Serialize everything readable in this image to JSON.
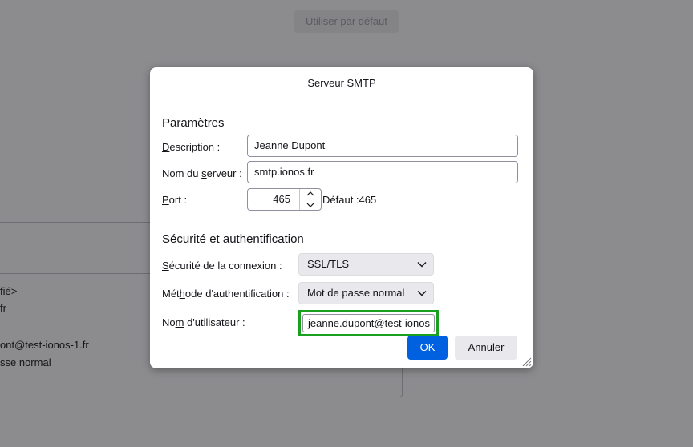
{
  "background": {
    "default_button_label": "Utiliser par défaut",
    "lines": [
      "fié>",
      "fr",
      "ont@test-ionos-1.fr",
      "sse normal"
    ]
  },
  "dialog": {
    "title": "Serveur SMTP",
    "settings_section": "Paramètres",
    "description_label_first": "D",
    "description_label_rest": "escription :",
    "description_value": "Jeanne Dupont",
    "server_label_pre": "Nom du ",
    "server_label_mnemonic": "s",
    "server_label_post": "erveur :",
    "server_value": "smtp.ionos.fr",
    "port_label_first": "P",
    "port_label_rest": "ort :",
    "port_value": "465",
    "port_default": "Défaut :465",
    "security_section": "Sécurité et authentification",
    "connection_security_label_first": "S",
    "connection_security_label_rest": "écurité de la connexion :",
    "connection_security_value": "SSL/TLS",
    "auth_method_label_pre": "Mét",
    "auth_method_label_mnemonic": "h",
    "auth_method_label_post": "ode d'authentification :",
    "auth_method_value": "Mot de passe normal",
    "username_label_pre": "No",
    "username_label_mnemonic": "m",
    "username_label_post": " d'utilisateur :",
    "username_value": "jeanne.dupont@test-ionos",
    "ok_label": "OK",
    "cancel_label": "Annuler"
  },
  "colors": {
    "accent": "#0061e0",
    "highlight": "#18a11f",
    "overlay": "#8c8c8f"
  }
}
